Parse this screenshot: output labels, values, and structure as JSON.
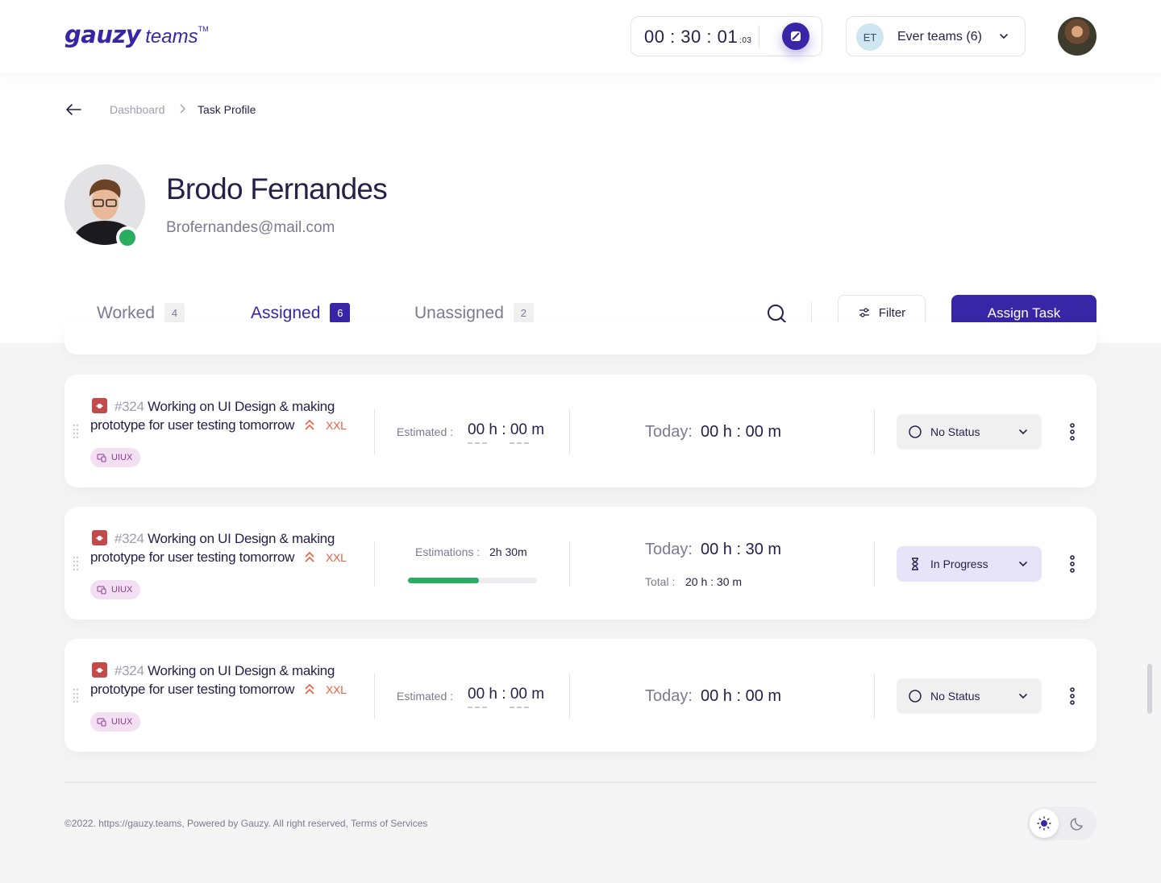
{
  "header": {
    "logo_main": "gauzy",
    "logo_sub": "teams",
    "logo_tm": "TM",
    "timer_value": "00 : 30 : 01",
    "timer_ms": ":03",
    "team_initials": "ET",
    "team_name": "Ever teams (6)"
  },
  "breadcrumb": {
    "first": "Dashboard",
    "current": "Task Profile"
  },
  "profile": {
    "name": "Brodo Fernandes",
    "email": "Brofernandes@mail.com"
  },
  "tabs": [
    {
      "label": "Worked",
      "count": "4"
    },
    {
      "label": "Assigned",
      "count": "6"
    },
    {
      "label": "Unassigned",
      "count": "2"
    }
  ],
  "actions": {
    "filter_label": "Filter",
    "assign_label": "Assign Task"
  },
  "tasks": [
    {
      "number": "#324",
      "title": "Working on UI Design & making prototype for user testing tomorrow",
      "size": "XXL",
      "tag": "UIUX",
      "estimated_label": "Estimated :",
      "estimated_value": "00  h : 00  m",
      "today_label": "Today:",
      "today_value": "00 h : 00 m",
      "status": "No Status"
    },
    {
      "number": "#324",
      "title": "Working on UI Design & making prototype for user testing tomorrow",
      "size": "XXL",
      "tag": "UIUX",
      "estimations_label": "Estimations :",
      "estimations_value": "2h 30m",
      "progress": 0.55,
      "today_label": "Today:",
      "today_value": "00 h : 30 m",
      "total_label": "Total :",
      "total_value": "20 h : 30 m",
      "status": "In Progress"
    },
    {
      "number": "#324",
      "title": "Working on UI Design & making prototype for user testing tomorrow",
      "size": "XXL",
      "tag": "UIUX",
      "estimated_label": "Estimated :",
      "estimated_value": "00  h : 00  m",
      "today_label": "Today:",
      "today_value": "00 h : 00 m",
      "status": "No Status"
    }
  ],
  "footer": {
    "text": "©2022. https://gauzy.teams, Powered by Gauzy. All right reserved, Terms of Services"
  },
  "colors": {
    "brand": "#3826a6",
    "success": "#27ae60",
    "size": "#ef5c3d",
    "tag_bg": "#f3dff2"
  }
}
